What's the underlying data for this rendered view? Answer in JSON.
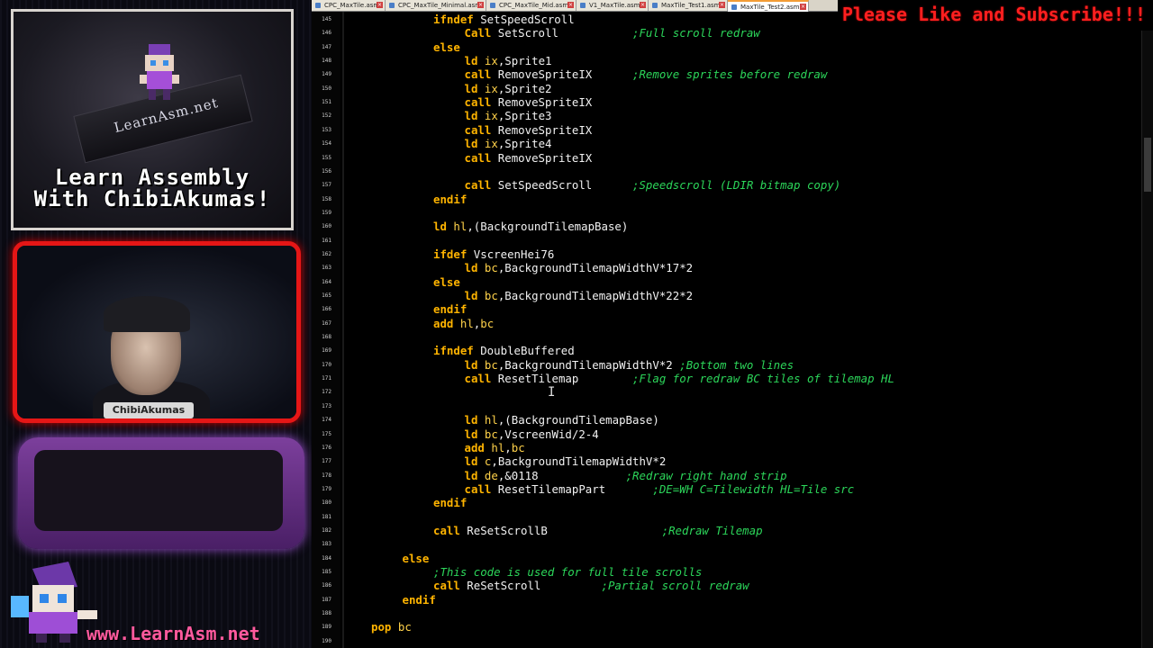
{
  "branding": {
    "chip_text": "LearnAsm.net",
    "title_line1": "Learn Assembly",
    "title_line2": "With ChibiAkumas!",
    "site": "www.LearnAsm.net",
    "subscribe": "Please Like and Subscribe!!!",
    "webcam_badge": "ChibiAkumas"
  },
  "colors": {
    "keyword": "#ffb400",
    "register": "#ffd24a",
    "text": "#f2f2f2",
    "comment": "#2cd65a",
    "cam_frame": "#e51616",
    "purple_frame": "#7c3f9c",
    "subscribe": "#ff1f1f",
    "site_label": "#ff5a9e"
  },
  "editor": {
    "tabs": [
      {
        "label": "CPC_MaxTile.asm",
        "active": false
      },
      {
        "label": "CPC_MaxTile_Minimal.asm",
        "active": false
      },
      {
        "label": "CPC_MaxTile_Mid.asm",
        "active": false
      },
      {
        "label": "V1_MaxTile.asm",
        "active": false
      },
      {
        "label": "MaxTile_Test1.asm",
        "active": false
      },
      {
        "label": "MaxTile_Test2.asm",
        "active": true
      }
    ],
    "lines": [
      {
        "n": "145",
        "indent": 2,
        "tokens": [
          [
            "kw",
            "ifndef"
          ],
          [
            "txt",
            " SetSpeedScroll"
          ]
        ]
      },
      {
        "n": "146",
        "indent": 3,
        "tokens": [
          [
            "kw",
            "Call"
          ],
          [
            "txt",
            " SetScroll           "
          ],
          [
            "cm",
            ";Full scroll redraw"
          ]
        ]
      },
      {
        "n": "147",
        "indent": 2,
        "tokens": [
          [
            "kw",
            "else"
          ]
        ]
      },
      {
        "n": "148",
        "indent": 3,
        "tokens": [
          [
            "kw",
            "ld"
          ],
          [
            "txt",
            " "
          ],
          [
            "reg",
            "ix"
          ],
          [
            "txt",
            ",Sprite1"
          ]
        ]
      },
      {
        "n": "149",
        "indent": 3,
        "tokens": [
          [
            "kw",
            "call"
          ],
          [
            "txt",
            " RemoveSpriteIX      "
          ],
          [
            "cm",
            ";Remove sprites before redraw"
          ]
        ]
      },
      {
        "n": "150",
        "indent": 3,
        "tokens": [
          [
            "kw",
            "ld"
          ],
          [
            "txt",
            " "
          ],
          [
            "reg",
            "ix"
          ],
          [
            "txt",
            ",Sprite2"
          ]
        ]
      },
      {
        "n": "151",
        "indent": 3,
        "tokens": [
          [
            "kw",
            "call"
          ],
          [
            "txt",
            " RemoveSpriteIX"
          ]
        ]
      },
      {
        "n": "152",
        "indent": 3,
        "tokens": [
          [
            "kw",
            "ld"
          ],
          [
            "txt",
            " "
          ],
          [
            "reg",
            "ix"
          ],
          [
            "txt",
            ",Sprite3"
          ]
        ]
      },
      {
        "n": "153",
        "indent": 3,
        "tokens": [
          [
            "kw",
            "call"
          ],
          [
            "txt",
            " RemoveSpriteIX"
          ]
        ]
      },
      {
        "n": "154",
        "indent": 3,
        "tokens": [
          [
            "kw",
            "ld"
          ],
          [
            "txt",
            " "
          ],
          [
            "reg",
            "ix"
          ],
          [
            "txt",
            ",Sprite4"
          ]
        ]
      },
      {
        "n": "155",
        "indent": 3,
        "tokens": [
          [
            "kw",
            "call"
          ],
          [
            "txt",
            " RemoveSpriteIX"
          ]
        ]
      },
      {
        "n": "156",
        "indent": 0,
        "tokens": []
      },
      {
        "n": "157",
        "indent": 3,
        "tokens": [
          [
            "kw",
            "call"
          ],
          [
            "txt",
            " SetSpeedScroll      "
          ],
          [
            "cm",
            ";Speedscroll (LDIR bitmap copy)"
          ]
        ]
      },
      {
        "n": "158",
        "indent": 2,
        "tokens": [
          [
            "kw",
            "endif"
          ]
        ]
      },
      {
        "n": "159",
        "indent": 0,
        "tokens": []
      },
      {
        "n": "160",
        "indent": 2,
        "tokens": [
          [
            "kw",
            "ld"
          ],
          [
            "txt",
            " "
          ],
          [
            "reg",
            "hl"
          ],
          [
            "txt",
            ",(BackgroundTilemapBase)"
          ]
        ]
      },
      {
        "n": "161",
        "indent": 0,
        "tokens": []
      },
      {
        "n": "162",
        "indent": 2,
        "tokens": [
          [
            "kw",
            "ifdef"
          ],
          [
            "txt",
            " VscreenHei76"
          ]
        ]
      },
      {
        "n": "163",
        "indent": 3,
        "tokens": [
          [
            "kw",
            "ld"
          ],
          [
            "txt",
            " "
          ],
          [
            "reg",
            "bc"
          ],
          [
            "txt",
            ",BackgroundTilemapWidthV*17*2"
          ]
        ]
      },
      {
        "n": "164",
        "indent": 2,
        "tokens": [
          [
            "kw",
            "else"
          ]
        ]
      },
      {
        "n": "165",
        "indent": 3,
        "tokens": [
          [
            "kw",
            "ld"
          ],
          [
            "txt",
            " "
          ],
          [
            "reg",
            "bc"
          ],
          [
            "txt",
            ",BackgroundTilemapWidthV*22*2"
          ]
        ]
      },
      {
        "n": "166",
        "indent": 2,
        "tokens": [
          [
            "kw",
            "endif"
          ]
        ]
      },
      {
        "n": "167",
        "indent": 2,
        "tokens": [
          [
            "kw",
            "add"
          ],
          [
            "txt",
            " "
          ],
          [
            "reg",
            "hl"
          ],
          [
            "txt",
            ","
          ],
          [
            "reg",
            "bc"
          ]
        ]
      },
      {
        "n": "168",
        "indent": 0,
        "tokens": []
      },
      {
        "n": "169",
        "indent": 2,
        "tokens": [
          [
            "kw",
            "ifndef"
          ],
          [
            "txt",
            " DoubleBuffered"
          ]
        ]
      },
      {
        "n": "170",
        "indent": 3,
        "tokens": [
          [
            "kw",
            "ld"
          ],
          [
            "txt",
            " "
          ],
          [
            "reg",
            "bc"
          ],
          [
            "txt",
            ",BackgroundTilemapWidthV*2 "
          ],
          [
            "cm",
            ";Bottom two lines"
          ]
        ]
      },
      {
        "n": "171",
        "indent": 3,
        "tokens": [
          [
            "kw",
            "call"
          ],
          [
            "txt",
            " ResetTilemap        "
          ],
          [
            "cm",
            ";Flag for redraw BC tiles of tilemap HL"
          ]
        ]
      },
      {
        "n": "172",
        "indent": 0,
        "tokens": []
      },
      {
        "n": "173",
        "indent": 0,
        "tokens": []
      },
      {
        "n": "174",
        "indent": 3,
        "tokens": [
          [
            "kw",
            "ld"
          ],
          [
            "txt",
            " "
          ],
          [
            "reg",
            "hl"
          ],
          [
            "txt",
            ",(BackgroundTilemapBase)"
          ]
        ]
      },
      {
        "n": "175",
        "indent": 3,
        "tokens": [
          [
            "kw",
            "ld"
          ],
          [
            "txt",
            " "
          ],
          [
            "reg",
            "bc"
          ],
          [
            "txt",
            ",VscreenWid/2-4"
          ]
        ]
      },
      {
        "n": "176",
        "indent": 3,
        "tokens": [
          [
            "kw",
            "add"
          ],
          [
            "txt",
            " "
          ],
          [
            "reg",
            "hl"
          ],
          [
            "txt",
            ","
          ],
          [
            "reg",
            "bc"
          ]
        ]
      },
      {
        "n": "177",
        "indent": 3,
        "tokens": [
          [
            "kw",
            "ld"
          ],
          [
            "txt",
            " "
          ],
          [
            "reg",
            "c"
          ],
          [
            "txt",
            ",BackgroundTilemapWidthV*2"
          ]
        ]
      },
      {
        "n": "178",
        "indent": 3,
        "tokens": [
          [
            "kw",
            "ld"
          ],
          [
            "txt",
            " "
          ],
          [
            "reg",
            "de"
          ],
          [
            "txt",
            ",&0118             "
          ],
          [
            "cm",
            ";Redraw right hand strip"
          ]
        ]
      },
      {
        "n": "179",
        "indent": 3,
        "tokens": [
          [
            "kw",
            "call"
          ],
          [
            "txt",
            " ResetTilemapPart       "
          ],
          [
            "cm",
            ";DE=WH C=Tilewidth HL=Tile src"
          ]
        ]
      },
      {
        "n": "180",
        "indent": 2,
        "tokens": [
          [
            "kw",
            "endif"
          ]
        ]
      },
      {
        "n": "181",
        "indent": 0,
        "tokens": []
      },
      {
        "n": "182",
        "indent": 2,
        "tokens": [
          [
            "kw",
            "call"
          ],
          [
            "txt",
            " ReSetScrollB                 "
          ],
          [
            "cm",
            ";Redraw Tilemap"
          ]
        ]
      },
      {
        "n": "183",
        "indent": 0,
        "tokens": []
      },
      {
        "n": "184",
        "indent": 1,
        "tokens": [
          [
            "kw",
            "else"
          ]
        ]
      },
      {
        "n": "185",
        "indent": 2,
        "tokens": [
          [
            "cm",
            ";This code is used for full tile scrolls"
          ]
        ]
      },
      {
        "n": "186",
        "indent": 2,
        "tokens": [
          [
            "kw",
            "call"
          ],
          [
            "txt",
            " ReSetScroll         "
          ],
          [
            "cm",
            ";Partial scroll redraw"
          ]
        ]
      },
      {
        "n": "187",
        "indent": 1,
        "tokens": [
          [
            "kw",
            "endif"
          ]
        ]
      },
      {
        "n": "188",
        "indent": 0,
        "tokens": []
      },
      {
        "n": "189",
        "indent": 0,
        "tokens": [
          [
            "kw",
            "pop"
          ],
          [
            "txt",
            " "
          ],
          [
            "reg",
            "bc"
          ]
        ]
      },
      {
        "n": "190",
        "indent": 0,
        "tokens": []
      }
    ]
  }
}
